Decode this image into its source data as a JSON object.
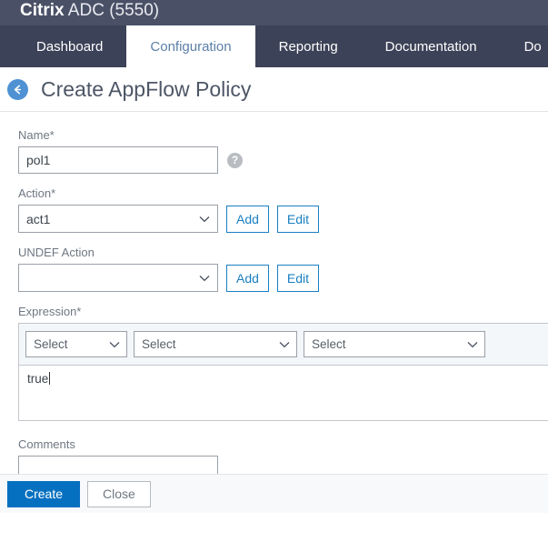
{
  "header": {
    "brand_strong": "Citrix",
    "brand_rest": " ADC (5550)"
  },
  "nav": {
    "tabs": [
      {
        "label": "Dashboard",
        "active": false
      },
      {
        "label": "Configuration",
        "active": true
      },
      {
        "label": "Reporting",
        "active": false
      },
      {
        "label": "Documentation",
        "active": false
      },
      {
        "label": "Do",
        "active": false
      }
    ]
  },
  "page": {
    "title": "Create AppFlow Policy",
    "back_icon": "arrow-left-icon"
  },
  "form": {
    "name": {
      "label": "Name*",
      "value": "pol1",
      "placeholder": "",
      "help_icon": "question-mark-icon"
    },
    "action": {
      "label": "Action*",
      "value": "act1",
      "add_label": "Add",
      "edit_label": "Edit"
    },
    "undef_action": {
      "label": "UNDEF Action",
      "value": "",
      "add_label": "Add",
      "edit_label": "Edit"
    },
    "expression": {
      "label": "Expression*",
      "selects": [
        {
          "value": "Select"
        },
        {
          "value": "Select"
        },
        {
          "value": "Select"
        }
      ],
      "text": "true"
    },
    "comments": {
      "label": "Comments",
      "value": "",
      "placeholder": ""
    }
  },
  "footer": {
    "create_label": "Create",
    "close_label": "Close"
  },
  "colors": {
    "brandbar": "#4a5167",
    "navbar": "#3c4257",
    "accent_blue": "#0670c0",
    "link_blue": "#1a7fc1",
    "back_circle": "#4e92d4"
  }
}
